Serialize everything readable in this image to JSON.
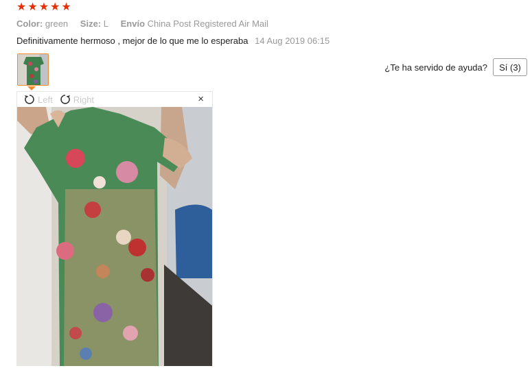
{
  "rating": {
    "stars": 5,
    "star_glyph": "★",
    "color": "#e62e04"
  },
  "meta": {
    "color_label": "Color:",
    "color_value": "green",
    "size_label": "Size:",
    "size_value": "L",
    "shipping_label": "Envío",
    "shipping_value": "China Post Registered Air Mail"
  },
  "review": {
    "text": "Definitivamente hermoso , mejor de lo que me lo esperaba",
    "date": "14 Aug 2019 06:15"
  },
  "helpful": {
    "question": "¿Te ha servido de ayuda?",
    "yes_label": "Sí (3)"
  },
  "viewer": {
    "rotate_left_label": "Left",
    "rotate_right_label": "Right",
    "close_glyph": "×"
  },
  "colors": {
    "accent": "#f48a2c",
    "muted": "#999999"
  }
}
